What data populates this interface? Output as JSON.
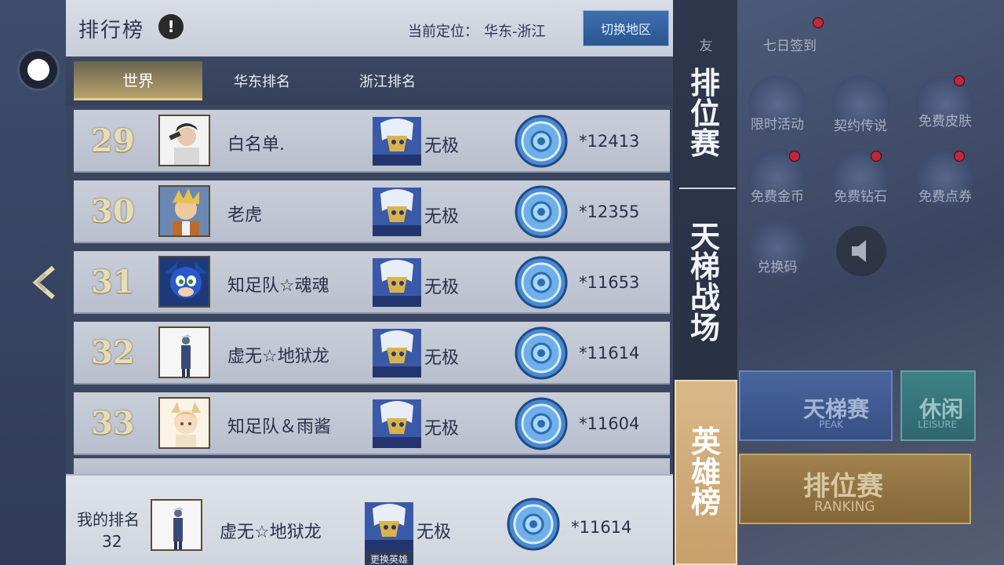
{
  "panel": {
    "title": "排行榜",
    "info_glyph": "!",
    "location_label": "当前定位：",
    "location_value": "华东-浙江",
    "switch_label": "切换地区"
  },
  "tabs": [
    "世界",
    "华东排名",
    "浙江排名"
  ],
  "rows": [
    {
      "rank": "29",
      "name": "白名单.",
      "hero": "无极",
      "score": "*12413"
    },
    {
      "rank": "30",
      "name": "老虎",
      "hero": "无极",
      "score": "*12355"
    },
    {
      "rank": "31",
      "name": "知足队☆魂魂",
      "hero": "无极",
      "score": "*11653"
    },
    {
      "rank": "32",
      "name": "虚无☆地狱龙",
      "hero": "无极",
      "score": "*11614"
    },
    {
      "rank": "33",
      "name": "知足队＆雨酱",
      "hero": "无极",
      "score": "*11604"
    }
  ],
  "my_rank": {
    "label": "我的排名",
    "rank": "32",
    "name": "虚无☆地狱龙",
    "hero": "无极",
    "score": "*11614",
    "change_hero_label": "更换英雄"
  },
  "side_tabs": [
    {
      "label": "排位赛",
      "chars": [
        "排",
        "位",
        "赛"
      ]
    },
    {
      "label": "天梯战场",
      "chars": [
        "天",
        "梯",
        "战",
        "场"
      ]
    },
    {
      "label": "英雄榜",
      "chars": [
        "英",
        "雄",
        "榜"
      ]
    }
  ],
  "background": {
    "top_labels": [
      "友",
      "七日签到"
    ],
    "icons": [
      {
        "label": "限时活动",
        "icon": "clock-shield-icon"
      },
      {
        "label": "契约传说",
        "icon": "hero-portrait-icon"
      },
      {
        "label": "免费皮肤",
        "icon": "gift-box-icon"
      },
      {
        "label": "免费金币",
        "icon": "coin-icon"
      },
      {
        "label": "免费钻石",
        "icon": "diamond-icon"
      },
      {
        "label": "免费点券",
        "icon": "ticket-icon"
      },
      {
        "label": "兑换码",
        "icon": "tag-icon"
      }
    ],
    "peak": {
      "title": "天梯赛",
      "subtitle": "PEAK"
    },
    "leisure": {
      "title": "休闲",
      "subtitle": "LEISURE"
    },
    "ranking": {
      "title": "排位赛",
      "subtitle": "RANKING"
    }
  },
  "colors": {
    "accent_gold": "#e2cf8c",
    "switch_blue": "#2a558f",
    "active_side_tab": "#c79f6c",
    "red_badge": "#c2263a"
  }
}
